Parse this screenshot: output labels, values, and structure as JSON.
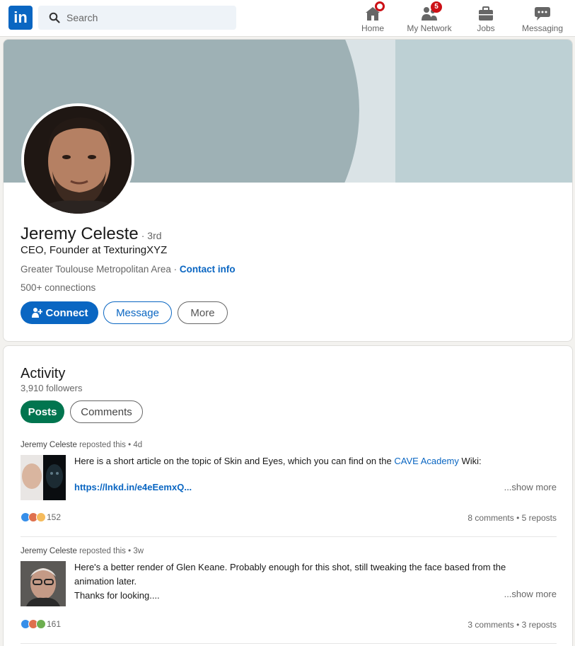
{
  "nav": {
    "logo_text": "in",
    "search_placeholder": "Search",
    "items": [
      {
        "label": "Home",
        "icon": "home-icon"
      },
      {
        "label": "My Network",
        "icon": "people-icon",
        "badge": "5"
      },
      {
        "label": "Jobs",
        "icon": "briefcase-icon"
      },
      {
        "label": "Messaging",
        "icon": "chat-icon"
      }
    ],
    "colors": {
      "brand": "#0a66c2",
      "badge": "#cc1016"
    }
  },
  "profile": {
    "name": "Jeremy Celeste",
    "degree": "· 3rd",
    "headline": "CEO, Founder at TexturingXYZ",
    "location": "Greater Toulouse Metropolitan Area",
    "location_separator": " · ",
    "contact_link": "Contact info",
    "connections": "500+ connections",
    "buttons": {
      "connect": "Connect",
      "message": "Message",
      "more": "More"
    }
  },
  "activity": {
    "title": "Activity",
    "followers": "3,910 followers",
    "tabs": {
      "posts": "Posts",
      "comments": "Comments"
    },
    "posts": [
      {
        "author": "Jeremy Celeste",
        "action": " reposted this • 4d",
        "text_before": "Here is a short article on the topic of Skin and Eyes, which you can find on the ",
        "text_link": "CAVE Academy",
        "text_after": " Wiki:",
        "link": "https://lnkd.in/e4eEemxQ...",
        "show_more": "...show more",
        "reaction_count": "152",
        "stats": "8 comments • 5 reposts"
      },
      {
        "author": "Jeremy Celeste",
        "action": " reposted this • 3w",
        "text_line1": "Here's a better render of Glen Keane. Probably enough for this shot, still tweaking the face based from the",
        "text_line2": "animation later.",
        "text_line3": "Thanks for looking....",
        "show_more": "...show more",
        "reaction_count": "161",
        "stats": "3 comments • 3 reposts"
      }
    ]
  }
}
